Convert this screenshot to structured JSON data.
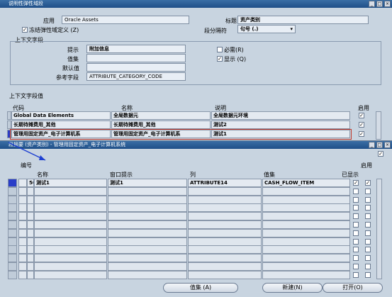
{
  "top_window": {
    "title": "说明性弹性域段"
  },
  "header": {
    "app_label": "应用",
    "app_value": "Oracle Assets",
    "title_label": "标题",
    "title_value": "资产类别",
    "freeze_label": "冻结弹性域定义 (Z)",
    "separator_label": "段分隔符",
    "separator_value": "句号 (.)"
  },
  "context_field": {
    "section_title": "上下文字段",
    "prompt_label": "提示",
    "prompt_value": "附加信息",
    "valueset_label": "值集",
    "default_label": "默认值",
    "ref_label": "参考字段",
    "ref_value": "ATTRIBUTE_CATEGORY_CODE",
    "required_label": "必需(R)",
    "display_label": "显示 (Q)"
  },
  "context_values": {
    "section_title": "上下文字段值",
    "col_code": "代码",
    "col_name": "名称",
    "col_desc": "说明",
    "col_enabled": "启用",
    "rows": [
      {
        "code": "Global Data Elements",
        "name": "全局数据元",
        "desc": "全局数据元环境"
      },
      {
        "code": "长期待摊费用_其他",
        "name": "长期待摊费用_其他",
        "desc": "测试2"
      },
      {
        "code": "管理用固定资产_电子计算机系",
        "name": "管理用固定资产_电子计算机系",
        "desc": "测试1"
      }
    ]
  },
  "segments_window": {
    "title": "段摘要 (资产类别) - 管理用固定资产_电子计算机系统",
    "col_num": "编号",
    "col_name": "名称",
    "col_prompt": "窗口提示",
    "col_column": "列",
    "col_valueset": "值集",
    "col_displayed": "已显示",
    "col_enabled": "启用",
    "row": {
      "num": "50",
      "name": "测试1",
      "prompt": "测试1",
      "column": "ATTRIBUTE14",
      "valueset": "CASH_FLOW_ITEM"
    },
    "buttons": {
      "valueset": "值集 (A)",
      "new": "新建(N)",
      "open": "打开(O)"
    }
  },
  "colors": {
    "titlebar": "#1f4f88",
    "highlight_box": "#c0392b",
    "arrow": "#1d3fd1"
  }
}
